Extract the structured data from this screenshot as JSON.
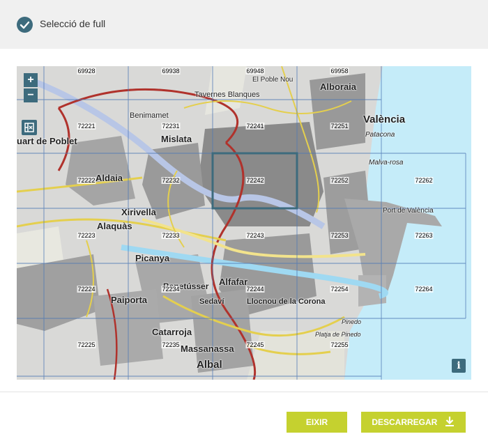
{
  "header": {
    "title": "Selecció de full",
    "icon": "check-circle-icon"
  },
  "map": {
    "zoom_in_label": "+",
    "zoom_out_label": "−",
    "info_label": "i",
    "sheet_labels": [
      "69928",
      "69938",
      "69948",
      "69958",
      "72221",
      "72231",
      "72241",
      "72251",
      "72222",
      "72232",
      "72242",
      "72252",
      "72262",
      "72223",
      "72233",
      "72243",
      "72253",
      "72263",
      "72224",
      "72234",
      "72244",
      "72254",
      "72264",
      "72225",
      "72235",
      "72245",
      "72255"
    ],
    "place_names": [
      "Alboraia",
      "València",
      "Mislata",
      "uart de Poblet",
      "Aldaia",
      "Xirivella",
      "Alaquàs",
      "Picanya",
      "Alfafar",
      "Paiporta",
      "Catarroja",
      "Massanassa",
      "Albal",
      "Benetússer",
      "Sedaví",
      "Llocnou de la Corona",
      "Tavernes Blanques",
      "Patacona",
      "Benimamet",
      "El Poble Nou",
      "Malva-rosa",
      "Port de València",
      "Pinedo",
      "Platja de Pinedo"
    ],
    "colors": {
      "sea": "#c5ecf9",
      "land": "#d9d9d7",
      "grid": "#4f79b5",
      "selected": "#3d6b7d"
    }
  },
  "footer": {
    "exit_label": "EIXIR",
    "download_label": "DESCARREGAR",
    "button_color": "#c5d12f"
  }
}
